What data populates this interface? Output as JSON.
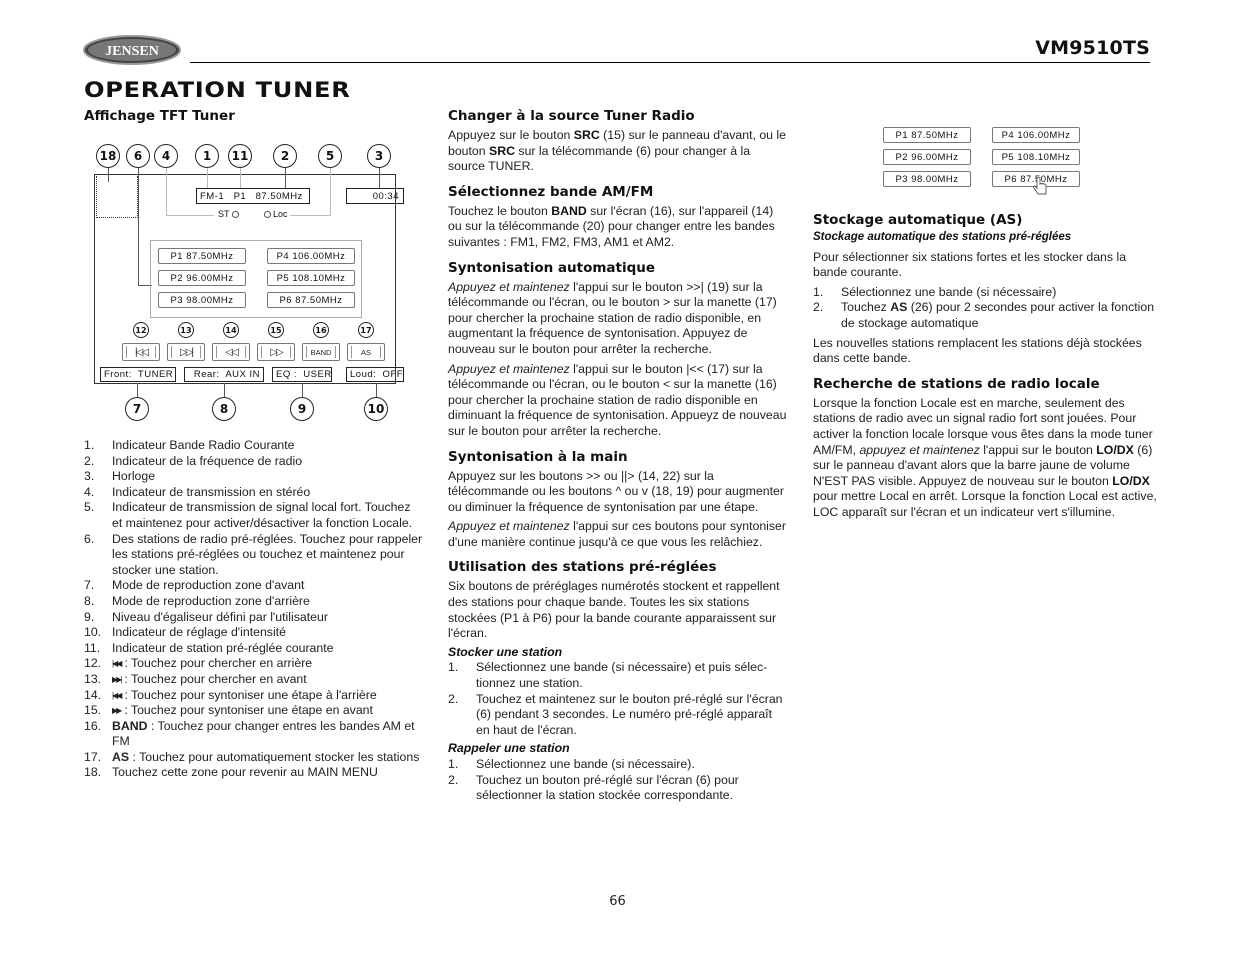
{
  "header": {
    "brand": "JENSEN",
    "model": "VM9510TS",
    "page_title": "OPERATION TUNER"
  },
  "col1": {
    "heading": "Affichage TFT Tuner",
    "diagram": {
      "callouts_top": [
        "18",
        "6",
        "4",
        "1",
        "11",
        "2",
        "5",
        "3"
      ],
      "callouts_bottom": [
        "7",
        "8",
        "9",
        "10"
      ],
      "callouts_controls": [
        "12",
        "13",
        "14",
        "15",
        "16",
        "17"
      ],
      "band_freq": "FM-1   P1   87.50MHz",
      "clock": "00:34",
      "st_label": "ST",
      "loc_label": "Loc",
      "presets": [
        {
          "label": "P1   87.50MHz"
        },
        {
          "label": "P2   96.00MHz"
        },
        {
          "label": "P3  98.00MHz"
        },
        {
          "label": "P4   106.00MHz"
        },
        {
          "label": "P5   108.10MHz"
        },
        {
          "label": "P6   87.50MHz"
        }
      ],
      "controls": [
        {
          "icon": "seek-back-icon",
          "glyph": "|◁◁"
        },
        {
          "icon": "seek-forward-icon",
          "glyph": "▷▷|"
        },
        {
          "icon": "step-back-icon",
          "glyph": "◁◁"
        },
        {
          "icon": "step-forward-icon",
          "glyph": "▷▷"
        },
        {
          "label": "BAND"
        },
        {
          "label": "AS"
        }
      ],
      "status": [
        "Front:  TUNER",
        "Rear:  AUX IN",
        "EQ :  USER",
        "Loud:  OFF"
      ]
    },
    "legend": [
      {
        "num": "1.",
        "text": "Indicateur Bande Radio Courante"
      },
      {
        "num": "2.",
        "text": "Indicateur de la fréquence de radio"
      },
      {
        "num": "3.",
        "text": "Horloge"
      },
      {
        "num": "4.",
        "text": "Indicateur de transmission en stéréo"
      },
      {
        "num": "5.",
        "text": "Indicateur de transmission de signal local fort. Touchez et maintenez pour activer/désactiver la fonction Locale."
      },
      {
        "num": "6.",
        "text": "Des stations de radio pré-réglées. Touchez pour rappeler les stations pré-réglées ou touchez et maintenez pour stocker une station."
      },
      {
        "num": "7.",
        "text": "Mode de reproduction zone d'avant"
      },
      {
        "num": "8.",
        "text": "Mode de reproduction zone d'arrière"
      },
      {
        "num": "9.",
        "text": "Niveau d'égaliseur défini par l'utilisateur"
      },
      {
        "num": "10.",
        "text": "Indicateur de réglage d'intensité"
      },
      {
        "num": "11.",
        "text": "Indicateur de station pré-réglée courante"
      },
      {
        "num": "12.",
        "icon": "|◀◀",
        "text": ": Touchez pour chercher en arrière"
      },
      {
        "num": "13.",
        "icon": "▶▶|",
        "text": ": Touchez pour chercher en avant"
      },
      {
        "num": "14.",
        "icon": "|◀◀",
        "text": ": Touchez pour syntoniser une étape à l'arrière"
      },
      {
        "num": "15.",
        "icon": "▶▶",
        "text": ": Touchez pour syntoniser une étape en avant"
      },
      {
        "num": "16.",
        "bold": "BAND",
        "text": " : Touchez pour changer entres les bandes AM et FM"
      },
      {
        "num": "17.",
        "bold": "AS",
        "text": " : Touchez pour automatiquement stocker les stations"
      },
      {
        "num": "18.",
        "text": "Touchez cette zone pour revenir au MAIN MENU"
      }
    ]
  },
  "col2": {
    "s1": {
      "heading": "Changer à la source Tuner Radio",
      "t1": "Appuyez sur le bouton ",
      "b1": "SRC",
      "t2": " (15) sur le panneau d'avant, ou le bouton ",
      "b2": "SRC",
      "t3": " sur la télécommande (6) pour changer à la source TUNER."
    },
    "s2": {
      "heading": "Sélectionnez bande AM/FM",
      "t1": "Touchez le bouton ",
      "b1": "BAND",
      "t2": " sur l'écran (16), sur l'appareil (14) ou sur la télécommande (20) pour changer entre les bandes suivantes : FM1, FM2, FM3, AM1 et AM2."
    },
    "s3": {
      "heading": "Syntonisation automatique",
      "p1_i": "Appuyez et maintenez",
      "p1": " l'appui sur le bouton >>| (19) sur la télécommande ou l'écran, ou le bouton > sur la manette (17) pour chercher la prochaine station de radio disponible, en augmentant la fréquence de syntonisation. Appuyez de nouveau sur le bouton pour arrêter la recherche.",
      "p2_i": "Appuyez et maintenez",
      "p2": " l'appui sur le bouton |<< (17) sur la télécommande ou l'écran, ou le bouton < sur la manette (16) pour chercher la prochaine station de radio disponible en diminuant la fréquence de syntonisation. Appueyz de nouveau sur le bouton pour arrêter la recherche."
    },
    "s4": {
      "heading": "Syntonisation à la main",
      "p1": "Appuyez sur les boutons >> ou ||> (14, 22) sur la télécommande ou les boutons ^ ou v  (18, 19) pour augmenter ou diminuer la fréquence de syntonisation par une étape.",
      "p2_i": "Appuyez et maintenez",
      "p2": " l'appui sur ces boutons pour syntoniser d'une manière continue jusqu'à ce que vous les relâchiez."
    },
    "s5": {
      "heading": "Utilisation des stations pré-réglées",
      "p1": "Six boutons de préréglages numérotés stockent et rappellent des stations pour chaque bande. Toutes les six stations stockées (P1 à P6) pour la bande courante apparaissent sur l'écran.",
      "store_heading": "Stocker une station",
      "store_steps": [
        {
          "num": "1.",
          "text": "Sélectionnez une bande (si nécessaire) et puis sélec-tionnez une station."
        },
        {
          "num": "2.",
          "text": "Touchez et maintenez sur le bouton pré-réglé sur l'écran (6) pendant 3 secondes. Le numéro pré-réglé apparaît en haut de l'écran."
        }
      ],
      "recall_heading": "Rappeler une station",
      "recall_steps": [
        {
          "num": "1.",
          "text": "Sélectionnez une bande (si nécessaire)."
        },
        {
          "num": "2.",
          "text": "Touchez un bouton pré-réglé sur l'écran (6) pour sélectionner la station stockée correspondante."
        }
      ]
    }
  },
  "col3": {
    "presets": [
      {
        "label": "P1   87.50MHz"
      },
      {
        "label": "P2   96.00MHz"
      },
      {
        "label": "P3  98.00MHz"
      },
      {
        "label": "P4   106.00MHz"
      },
      {
        "label": "P5   108.10MHz"
      },
      {
        "label": "P6   87.50MHz"
      }
    ],
    "s1": {
      "heading": "Stockage automatique (AS)",
      "subheading": "Stockage automatique des stations pré-réglées",
      "p1": "Pour sélectionner six stations fortes et les stocker dans la bande courante.",
      "step1": "Sélectionnez une bande (si nécessaire)",
      "step2_a": "Touchez ",
      "step2_b": "AS",
      "step2_c": " (26) pour 2 secondes pour activer la fonction de stockage automatique",
      "p2": "Les nouvelles stations remplacent les stations déjà stockées dans cette bande."
    },
    "s2": {
      "heading": "Recherche de stations de radio locale",
      "t1": "Lorsque la fonction Locale est en marche, seulement des stations de radio avec un signal radio fort sont jouées. Pour activer la fonction locale lorsque vous êtes dans la mode tuner AM/FM, ",
      "i1": "appuyez et maintenez",
      "t2": " l'appui sur le bouton ",
      "b1": "LO/DX",
      "t3": " (6) sur le panneau d'avant alors que la barre jaune de volume N'EST PAS visible. Appuyez de nouveau sur le bouton ",
      "b2": "LO/DX",
      "t4": " pour mettre Local en arrêt. Lorsque la fonction Local est active, LOC apparaît sur l'écran et un indicateur vert s'illumine."
    }
  },
  "footer": {
    "page_number": "66"
  }
}
